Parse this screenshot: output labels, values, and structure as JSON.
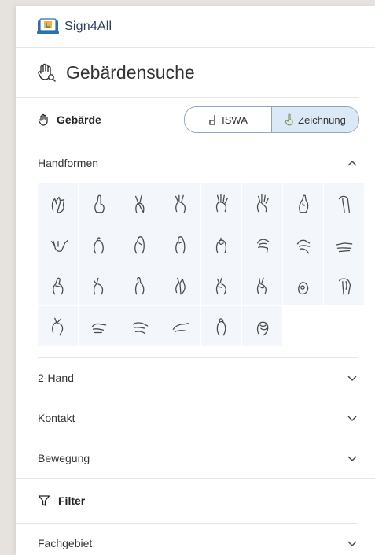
{
  "app": {
    "name": "Sign4All"
  },
  "search": {
    "title": "Gebärdensuche"
  },
  "gebaerde": {
    "label": "Gebärde",
    "options": [
      {
        "label": "ISWA",
        "icon": "iswa-glyph-icon",
        "active": false
      },
      {
        "label": "Zeichnung",
        "icon": "hand-drawing-icon",
        "active": true
      }
    ]
  },
  "handformen": {
    "label": "Handformen",
    "expanded": true,
    "shapes": [
      "handshape-1",
      "handshape-2",
      "handshape-3",
      "handshape-4",
      "handshape-5",
      "handshape-6",
      "handshape-7",
      "handshape-8",
      "handshape-9",
      "handshape-10",
      "handshape-11",
      "handshape-12",
      "handshape-13",
      "handshape-14",
      "handshape-15",
      "handshape-16",
      "handshape-17",
      "handshape-18",
      "handshape-19",
      "handshape-20",
      "handshape-21",
      "handshape-22",
      "handshape-23",
      "handshape-24",
      "handshape-25",
      "handshape-26",
      "handshape-27",
      "handshape-28",
      "handshape-29",
      "handshape-30"
    ]
  },
  "sections": [
    {
      "label": "2-Hand"
    },
    {
      "label": "Kontakt"
    },
    {
      "label": "Bewegung"
    }
  ],
  "filter": {
    "label": "Filter"
  },
  "fachgebiet": {
    "label": "Fachgebiet"
  },
  "colors": {
    "accent": "#8ea6c0",
    "active_bg": "#dbe8f5",
    "cell_bg": "#f3f6fa",
    "brand_text": "#2b3f5a"
  }
}
